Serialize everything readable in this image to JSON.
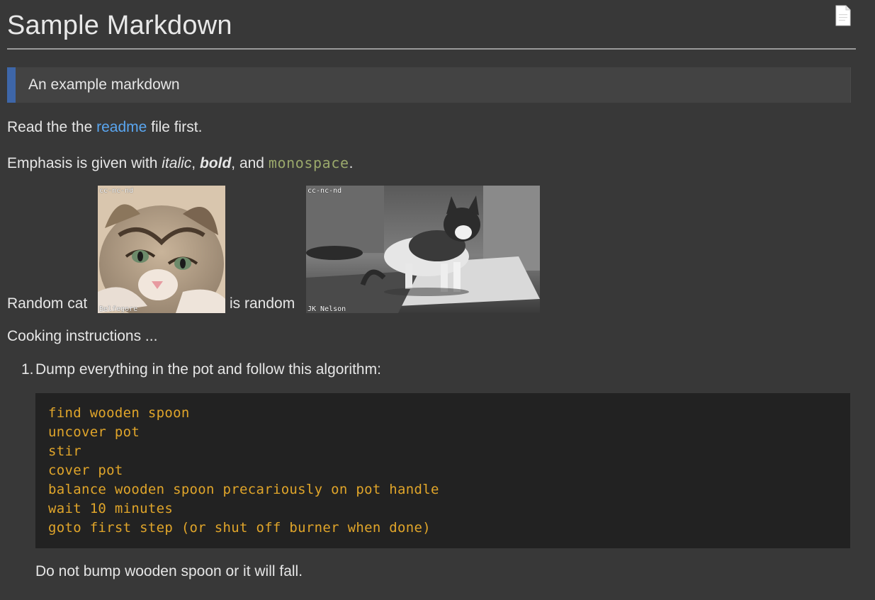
{
  "document": {
    "title": "Sample Markdown",
    "blockquote": "An example markdown",
    "para1": {
      "before": "Read the the ",
      "link": "readme",
      "after": " file first."
    },
    "para2": {
      "before": "Emphasis is given with ",
      "italic": "italic",
      "sep1": ", ",
      "bold": "bold",
      "sep2": ", and ",
      "mono": "monospace",
      "end": "."
    },
    "cat_row": {
      "text1": "Random cat",
      "text2": "is random",
      "image1": {
        "license": "cc-nc-nd",
        "credit": "Belfegore"
      },
      "image2": {
        "license": "cc-nc-nd",
        "credit": "JK Nelson"
      }
    },
    "para3": "Cooking instructions ...",
    "list": {
      "number": "1.",
      "text": "Dump everything in the pot and follow this algorithm:"
    },
    "code_lines": [
      "find wooden spoon",
      "uncover pot",
      "stir",
      "cover pot",
      "balance wooden spoon precariously on pot handle",
      "wait 10 minutes",
      "goto first step (or shut off burner when done)"
    ],
    "para4": "Do not bump wooden spoon or it will fall."
  },
  "icons": {
    "top_right": "document-icon"
  },
  "colors": {
    "background": "#383838",
    "link": "#5aa6f0",
    "code_text": "#e0a52a",
    "inline_mono": "#9aa86b",
    "blockquote_bar": "#3e66a8",
    "code_background": "#222222"
  }
}
